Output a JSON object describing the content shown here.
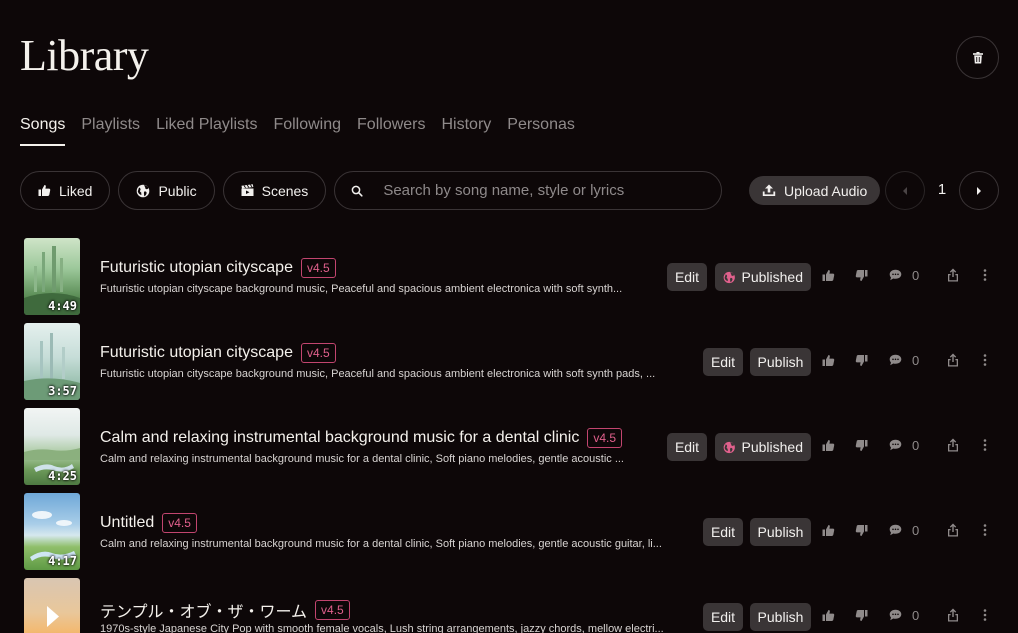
{
  "header": {
    "title": "Library"
  },
  "tabs": [
    {
      "label": "Songs",
      "active": true
    },
    {
      "label": "Playlists"
    },
    {
      "label": "Liked Playlists"
    },
    {
      "label": "Following"
    },
    {
      "label": "Followers"
    },
    {
      "label": "History"
    },
    {
      "label": "Personas"
    }
  ],
  "filters": {
    "liked": "Liked",
    "public": "Public",
    "scenes": "Scenes",
    "search_placeholder": "Search by song name, style or lyrics",
    "upload": "Upload Audio",
    "page": "1"
  },
  "colors": {
    "background": "#0d0708",
    "accent": "#e0608c",
    "button": "#3a3536",
    "muted": "#8f8a8a"
  },
  "songs": [
    {
      "title": "Futuristic utopian cityscape",
      "version": "v4.5",
      "description": "Futuristic utopian cityscape background music, Peaceful and spacious ambient electronica with soft synth...",
      "duration": "4:49",
      "edit": "Edit",
      "status": "Published",
      "likes": "0"
    },
    {
      "title": "Futuristic utopian cityscape",
      "version": "v4.5",
      "description": "Futuristic utopian cityscape background music, Peaceful and spacious ambient electronica with soft synth pads, ...",
      "duration": "3:57",
      "edit": "Edit",
      "status": "Publish",
      "likes": "0"
    },
    {
      "title": "Calm and relaxing instrumental background music for a dental clinic",
      "version": "v4.5",
      "description": "Calm and relaxing instrumental background music for a dental clinic, Soft piano melodies, gentle acoustic ...",
      "duration": "4:25",
      "edit": "Edit",
      "status": "Published",
      "likes": "0"
    },
    {
      "title": "Untitled",
      "version": "v4.5",
      "description": "Calm and relaxing instrumental background music for a dental clinic, Soft piano melodies, gentle acoustic guitar, li...",
      "duration": "4:17",
      "edit": "Edit",
      "status": "Publish",
      "likes": "0"
    },
    {
      "title": "テンプル・オブ・ザ・ワーム",
      "version": "v4.5",
      "description": "1970s-style Japanese City Pop with smooth female vocals, Lush string arrangements, jazzy chords, mellow electri...",
      "duration": "",
      "edit": "Edit",
      "status": "Publish",
      "likes": "0"
    }
  ]
}
